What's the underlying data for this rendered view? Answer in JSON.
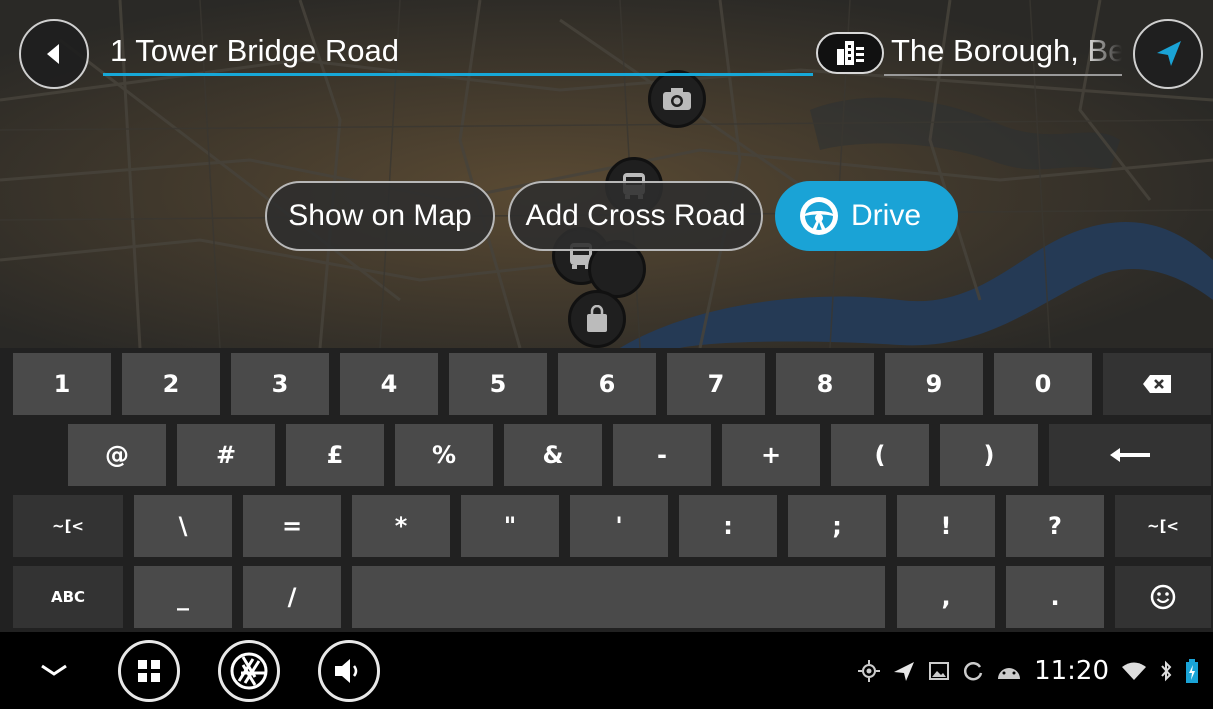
{
  "search": {
    "address_value": "1 Tower Bridge Road",
    "city_value": "The Borough, Bermondsey"
  },
  "actions": {
    "show_on_map": "Show on Map",
    "add_cross_road": "Add Cross Road",
    "drive": "Drive"
  },
  "keyboard": {
    "row1": [
      "1",
      "2",
      "3",
      "4",
      "5",
      "6",
      "7",
      "8",
      "9",
      "0"
    ],
    "row2": [
      "@",
      "#",
      "£",
      "%",
      "&",
      "-",
      "+",
      "(",
      ")"
    ],
    "row3": [
      "~[<",
      "\\",
      "=",
      "*",
      "\"",
      "'",
      ":",
      ";",
      "!",
      "?",
      "~[<"
    ],
    "row4": [
      "ABC",
      "_",
      "/",
      "",
      ",",
      "."
    ]
  },
  "status_bar": {
    "time": "11:20"
  },
  "colors": {
    "accent": "#1aa3d6",
    "key": "#4a4a4a",
    "key_dark": "#333333",
    "keyboard_bg": "#212121"
  },
  "icons": [
    "back-arrow-icon",
    "city-icon",
    "location-arrow-icon",
    "camera-icon",
    "bus-icon",
    "shopping-bag-icon",
    "steering-wheel-icon",
    "backspace-icon",
    "enter-icon",
    "emoji-icon",
    "chevron-down-icon",
    "apps-grid-icon",
    "camera-shutter-icon",
    "volume-icon",
    "gps-icon",
    "navigation-icon",
    "image-icon",
    "sync-icon",
    "android-icon",
    "wifi-icon",
    "bluetooth-icon",
    "battery-icon"
  ]
}
